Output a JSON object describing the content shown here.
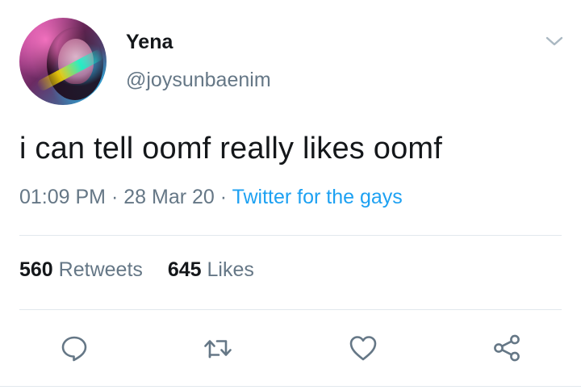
{
  "tweet": {
    "author": {
      "display_name": "Yena",
      "handle": "@joysunbaenim"
    },
    "text": "i can tell oomf really likes oomf",
    "time": "01:09 PM",
    "date": "28 Mar 20",
    "separator": "·",
    "source": "Twitter for the gays",
    "stats": {
      "retweets_count": "560",
      "retweets_label": "Retweets",
      "likes_count": "645",
      "likes_label": "Likes"
    }
  },
  "icons": {
    "menu": "chevron-down-icon",
    "reply": "reply-icon",
    "retweet": "retweet-icon",
    "like": "heart-icon",
    "share": "share-icon"
  },
  "colors": {
    "text": "#14171a",
    "secondary": "#657786",
    "link": "#1da1f2",
    "divider": "#e1e8ed",
    "icon": "#657786"
  }
}
